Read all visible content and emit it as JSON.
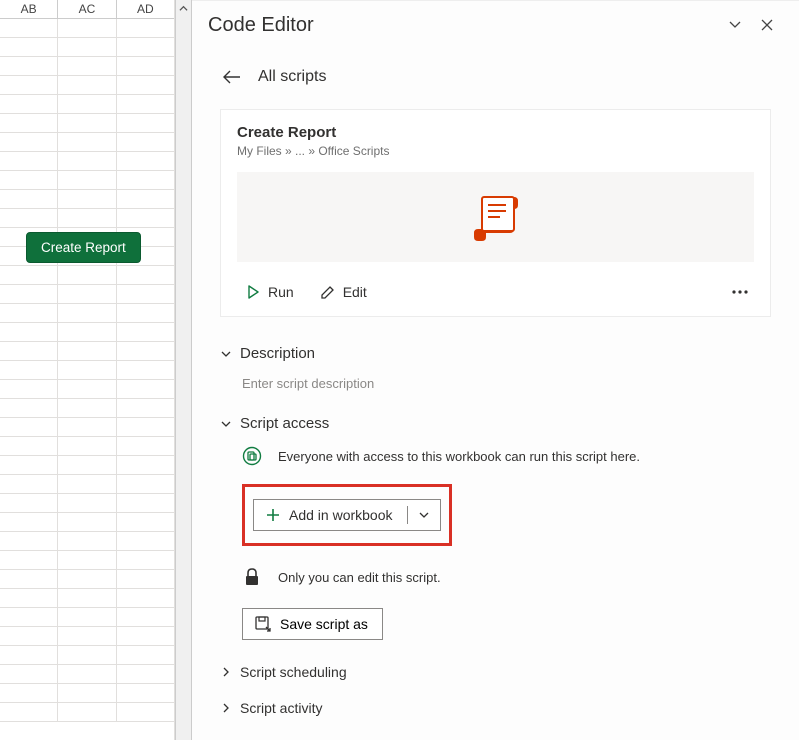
{
  "sheet": {
    "columns": [
      "AB",
      "AC",
      "AD"
    ],
    "button_label": "Create Report"
  },
  "pane": {
    "title": "Code Editor",
    "back_label": "All scripts",
    "script": {
      "name": "Create Report",
      "breadcrumb": "My Files » ... » Office Scripts"
    },
    "actions": {
      "run": "Run",
      "edit": "Edit"
    },
    "sections": {
      "description": {
        "title": "Description",
        "placeholder": "Enter script description"
      },
      "script_access": {
        "title": "Script access",
        "everyone_text": "Everyone with access to this workbook can run this script here.",
        "add_button": "Add in workbook",
        "only_you_text": "Only you can edit this script.",
        "save_as": "Save script as"
      },
      "scheduling": {
        "title": "Script scheduling"
      },
      "activity": {
        "title": "Script activity"
      }
    }
  }
}
